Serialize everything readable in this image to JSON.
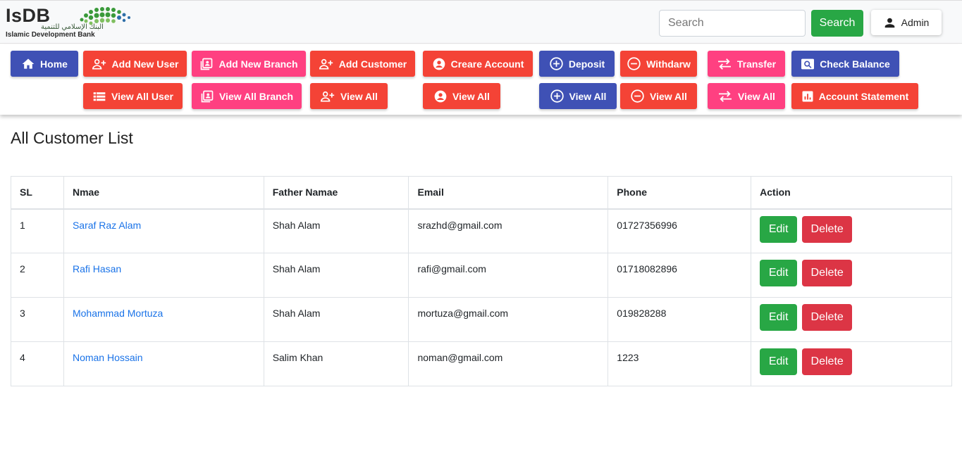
{
  "header": {
    "logo_text": "IsDB",
    "logo_subtitle": "Islamic Development Bank",
    "logo_arabic": "البنك الإسلامي للتنمية",
    "search_placeholder": "Search",
    "search_button": "Search",
    "admin_label": "Admin"
  },
  "nav": {
    "row1": {
      "home": "Home",
      "add_new_user": "Add New User",
      "add_new_branch": "Add New Branch",
      "add_customer": "Add Customer",
      "create_account": "Creare Account",
      "deposit": "Deposit",
      "withdraw": "Withdarw",
      "transfer": "Transfer",
      "check_balance": "Check Balance"
    },
    "row2": {
      "view_all_user": "View All User",
      "view_all_branch": "View All Branch",
      "view_all_customer": "View All",
      "view_all_account": "View All",
      "view_all_deposit": "View All",
      "view_all_withdraw": "View All",
      "view_all_transfer": "View All",
      "account_statement": "Account Statement"
    }
  },
  "main": {
    "title": "All Customer List",
    "table": {
      "headers": [
        "SL",
        "Nmae",
        "Father Namae",
        "Email",
        "Phone",
        "Action"
      ],
      "rows": [
        {
          "sl": "1",
          "name": "Saraf Raz Alam",
          "father": "Shah Alam",
          "email": "srazhd@gmail.com",
          "phone": "01727356996"
        },
        {
          "sl": "2",
          "name": "Rafi Hasan",
          "father": "Shah Alam",
          "email": "rafi@gmail.com",
          "phone": "01718082896"
        },
        {
          "sl": "3",
          "name": "Mohammad Mortuza",
          "father": "Shah Alam",
          "email": "mortuza@gmail.com",
          "phone": "019828288"
        },
        {
          "sl": "4",
          "name": "Noman Hossain",
          "father": "Salim Khan",
          "email": "noman@gmail.com",
          "phone": "1223"
        }
      ],
      "edit_label": "Edit",
      "delete_label": "Delete"
    }
  },
  "colors": {
    "indigo": "#3f51b5",
    "red": "#f44336",
    "pink": "#ff4081",
    "green": "#28a745",
    "danger": "#dc3545",
    "link": "#1a73e8"
  },
  "icons": {
    "home": "home-icon",
    "add_user": "person-add-icon",
    "branch": "contacts-icon",
    "account": "account-circle-icon",
    "deposit": "plus-circle-icon",
    "withdraw": "minus-circle-icon",
    "transfer": "swap-arrows-icon",
    "balance": "magnify-icon",
    "list": "list-icon",
    "statement": "bar-chart-icon",
    "admin": "person-icon"
  }
}
